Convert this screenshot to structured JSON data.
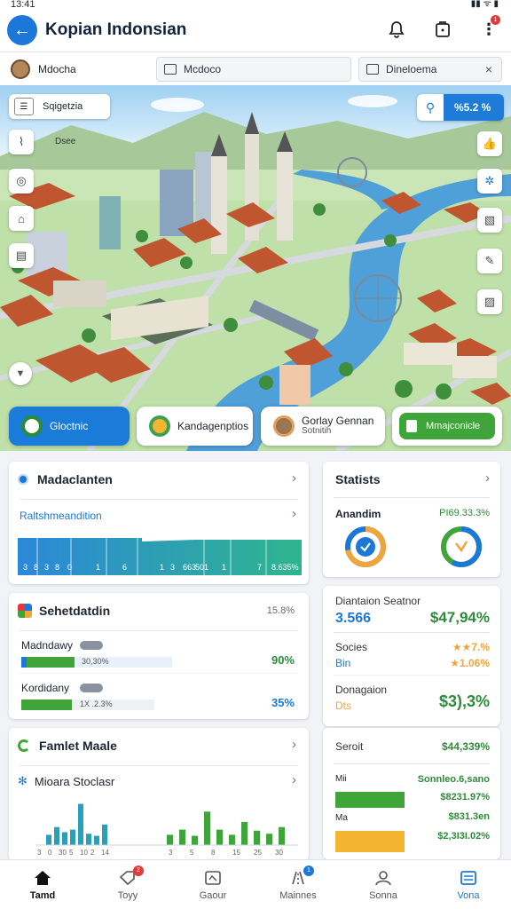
{
  "status_bar": {
    "time": "13:41",
    "indicators": "▮▮ ᯤ ▮"
  },
  "app_bar": {
    "title": "Kopian Indonsian",
    "back_icon": "back-arrow-icon",
    "notification_badge": "1"
  },
  "filter_row": {
    "user_label": "Mdocha",
    "field_1": "Mcdoco",
    "field_2": "Dineloema",
    "clear": "×"
  },
  "map": {
    "search_label": "Sqigetzia",
    "place_label": "Dsee",
    "zoom_text": "%5.2 %",
    "colors": {
      "water": "#4f9fd8",
      "land": "#bfe0a8",
      "road": "#d6d9de",
      "roof": "#c0562f"
    }
  },
  "pills": [
    {
      "label": "Gloctnic"
    },
    {
      "label": "Kandagenptios"
    },
    {
      "label": "Gorlay Gennan",
      "sub": "Sotnitih"
    },
    {
      "label": "Mmajconicle"
    }
  ],
  "card_madaclanten": {
    "title": "Madaclanten",
    "link": "Raltshmeandition",
    "axis_labels": [
      "3",
      "8",
      "3",
      "8",
      "0",
      "1",
      "6",
      "1",
      "3",
      "663",
      "501",
      "1",
      "7",
      "8.635%"
    ]
  },
  "card_statists": {
    "title": "Statists",
    "label": "Anandim",
    "value": "PI69.33.3%",
    "gauge_1_fill": 0.72,
    "gauge_2_fill": 0.58
  },
  "card_sehetdatdin": {
    "title": "Sehetdatdin",
    "value": "15.8%",
    "rows": [
      {
        "label": "Madndawy",
        "bar_text": "30,30%",
        "pct": "90%",
        "fill": 0.35
      },
      {
        "label": "Kordidany",
        "bar_text": "1X .2.3%",
        "pct": "35%",
        "fill": 0.38
      }
    ]
  },
  "card_plantation": {
    "title": "Diantaion Seatnor",
    "value_1": "3.566",
    "value_2": "$47,94%",
    "row_2_label": "Socies",
    "row_2_sub": "Bin",
    "row_2_val_a": "★★7.%",
    "row_2_val_b": "★1.06%",
    "row_3_label": "Donagaion",
    "row_3_sub": "Dts",
    "row_3_value": "$3),3%"
  },
  "card_famlet": {
    "title": "Famlet Maale",
    "sub_title": "Mioara Stoclasr",
    "axis_labels": [
      "3",
      "0",
      "30",
      "5",
      "10",
      "2",
      "14"
    ],
    "axis_labels_right": [
      "3",
      "5",
      "8",
      "15",
      "25",
      "30"
    ],
    "bars_teal": [
      20,
      35,
      25,
      30,
      80,
      22,
      18,
      40
    ],
    "bars_green": [
      20,
      30,
      18,
      65,
      30,
      20,
      45,
      28,
      22,
      35
    ]
  },
  "card_seroit": {
    "title": "Seroit",
    "value": "$44,339%",
    "rows": [
      {
        "label": "Mii",
        "value": "Sonnleo.6,sano"
      },
      {
        "label": "",
        "value": "$8231.97%"
      },
      {
        "label": "Ma",
        "value": "$831.3en"
      },
      {
        "label": "",
        "value": "$2,3I3I.02%"
      }
    ]
  },
  "tabs": [
    {
      "label": "Tamd",
      "icon": "home-icon",
      "badge": ""
    },
    {
      "label": "Toyy",
      "icon": "tag-icon",
      "badge": "2"
    },
    {
      "label": "Gaour",
      "icon": "map-icon",
      "badge": ""
    },
    {
      "label": "Mainnes",
      "icon": "route-icon",
      "badge": "1"
    },
    {
      "label": "Sonna",
      "icon": "person-icon",
      "badge": ""
    },
    {
      "label": "Vona",
      "icon": "list-icon",
      "badge": ""
    }
  ]
}
